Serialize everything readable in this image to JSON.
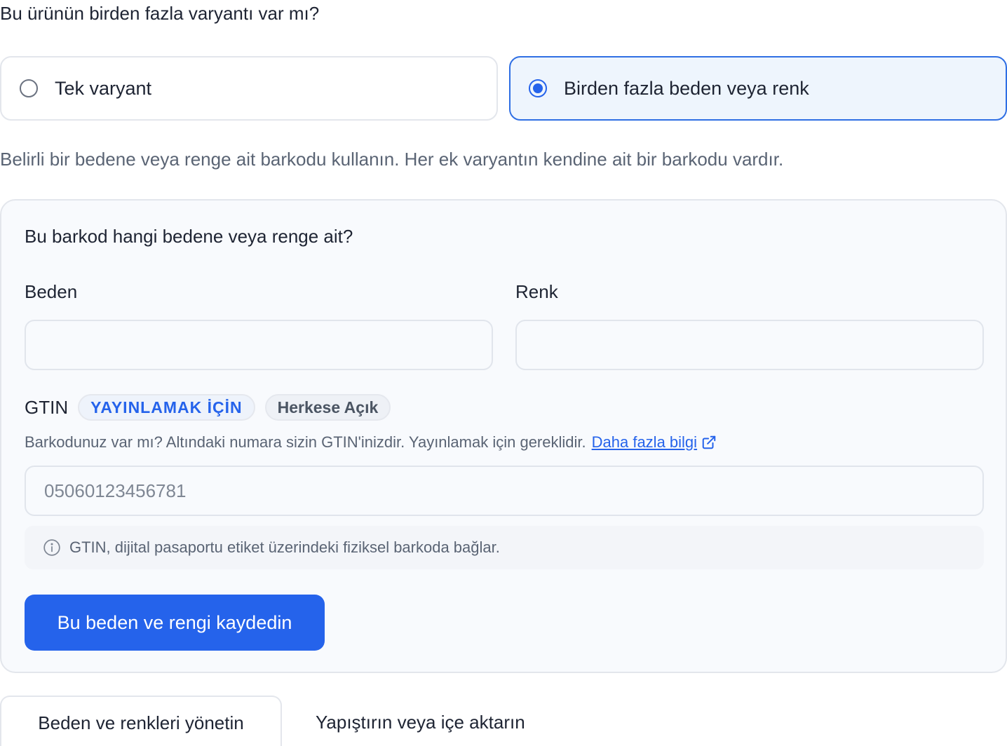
{
  "question": "Bu ürünün birden fazla varyantı var mı?",
  "options": [
    {
      "label": "Tek varyant",
      "selected": false
    },
    {
      "label": "Birden fazla beden veya renk",
      "selected": true
    }
  ],
  "helper_text": "Belirli bir bedene veya renge ait barkodu kullanın. Her ek varyantın kendine ait bir barkodu vardır.",
  "panel": {
    "title": "Bu barkod hangi bedene veya renge ait?",
    "size_label": "Beden",
    "size_value": "",
    "color_label": "Renk",
    "color_value": "",
    "gtin": {
      "label": "GTIN",
      "badge_publish": "YAYINLAMAK İÇİN",
      "badge_public": "Herkese Açık",
      "help_text": "Barkodunuz var mı? Altındaki numara sizin GTIN'inizdir. Yayınlamak için gereklidir.",
      "learn_more": "Daha fazla bilgi",
      "placeholder": "05060123456781",
      "value": ""
    },
    "info_text": "GTIN, dijital pasaportu etiket üzerindeki fiziksel barkoda bağlar.",
    "save_label": "Bu beden ve rengi kaydedin"
  },
  "footer": {
    "manage_label": "Beden ve renkleri yönetin",
    "paste_label": "Yapıştırın veya içe aktarın"
  },
  "colors": {
    "accent": "#2563eb",
    "selected_bg": "#eef5fd",
    "border": "#e3e6ec",
    "muted_text": "#5a6474"
  },
  "icons": [
    "info-icon",
    "external-link-icon"
  ]
}
